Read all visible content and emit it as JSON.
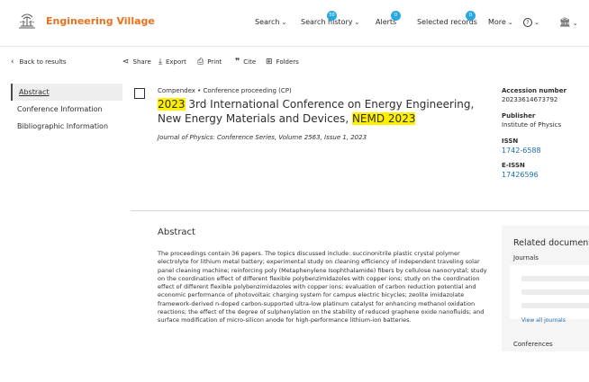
{
  "header": {
    "brand": "Engineering Village",
    "nav": {
      "search": "Search",
      "search_history": "Search history",
      "search_history_count": "50",
      "alerts": "Alerts",
      "alerts_count": "0",
      "selected_records": "Selected records",
      "selected_records_count": "0",
      "more": "More"
    }
  },
  "toolbar": {
    "back": "Back to results",
    "share": "Share",
    "export": "Export",
    "print": "Print",
    "cite": "Cite",
    "folders": "Folders"
  },
  "sidebar": {
    "items": [
      {
        "label": "Abstract"
      },
      {
        "label": "Conference Information"
      },
      {
        "label": "Bibliographic Information"
      }
    ]
  },
  "record": {
    "meta": "Compendex  •  Conference proceeding (CP)",
    "title_year": "2023",
    "title_mid": " 3rd International Conference on Energy Engineering, New Energy Materials and Devices, ",
    "title_acr": "NEMD 2023",
    "journal_name": "Journal of Physics: Conference Series",
    "journal_rest": ", Volume 2563, Issue 1, 2023"
  },
  "details": {
    "accession_label": "Accession number",
    "accession_value": "20233614673792",
    "publisher_label": "Publisher",
    "publisher_value": "Institute of Physics",
    "issn_label": "ISSN",
    "issn_value": "1742-6588",
    "eissn_label": "E-ISSN",
    "eissn_value": "17426596"
  },
  "abstract": {
    "heading": "Abstract",
    "text": "The proceedings contain 36 papers. The topics discussed include: succinonitrile plastic crystal polymer electrolyte for lithium metal battery; experimental study on cleaning efficiency of independent traveling solar panel cleaning machine; reinforcing poly (Metaphenylene Isophthalamide) fibers by cellulose nanocrystal; study on the coordination effect of different flexible polybenzimidazoles with copper ions; study on the coordination effect of different flexible polybenzimidazoles with copper ions; evaluation of carbon reduction potential and economic performance of photovoltaic charging system for campus electric bicycles; zeolite imidazolate framework-derived n-doped carbon-supported ultra-low platinum catalyst for enhancing methanol oxidation reactions; the effect of the degree of sulphenylation on the stability of reduced graphene oxide nanofluids; and surface modification of micro-silicon anode for high-performance lithium-ion batteries."
  },
  "related": {
    "heading": "Related documen",
    "journals": "Journals",
    "view_all": "View all journals",
    "conferences": "Conferences"
  },
  "colors": {
    "brand": "#e9711c",
    "link": "#1a6fb0",
    "highlight": "#fff000",
    "badge": "#29a9e0"
  }
}
